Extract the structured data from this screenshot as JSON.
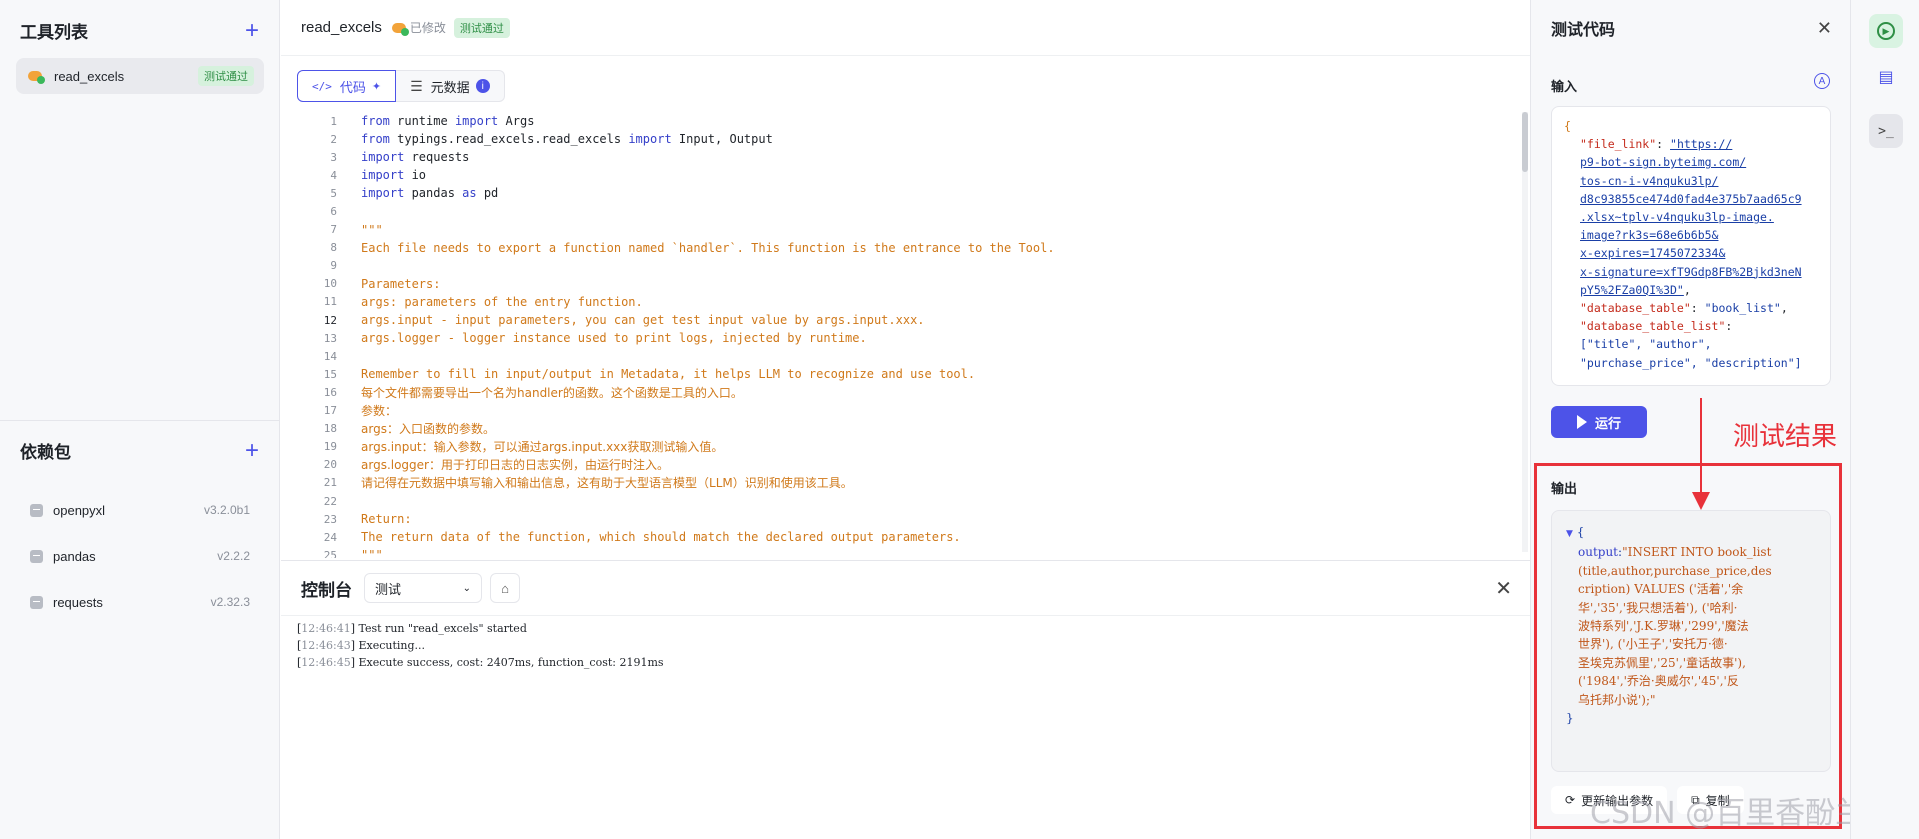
{
  "sidebar": {
    "tools_title": "工具列表",
    "tool_item": {
      "name": "read_excels",
      "status": "测试通过"
    },
    "deps_title": "依赖包",
    "deps": [
      {
        "name": "openpyxl",
        "version": "v3.2.0b1"
      },
      {
        "name": "pandas",
        "version": "v2.2.2"
      },
      {
        "name": "requests",
        "version": "v2.32.3"
      }
    ]
  },
  "header": {
    "filename": "read_excels",
    "modified": "已修改",
    "status": "测试通过"
  },
  "tabs": {
    "code": "代码",
    "metadata": "元数据"
  },
  "editor": {
    "lines": [
      "from runtime import Args",
      "from typings.read_excels.read_excels import Input, Output",
      "import requests",
      "import io",
      "import pandas as pd",
      "",
      "\"\"\"",
      "Each file needs to export a function named `handler`. This function is the entrance to the Tool.",
      "",
      "Parameters:",
      "args: parameters of the entry function.",
      "args.input - input parameters, you can get test input value by args.input.xxx.",
      "args.logger - logger instance used to print logs, injected by runtime.",
      "",
      "Remember to fill in input/output in Metadata, it helps LLM to recognize and use tool.",
      "每个文件都需要导出一个名为handler的函数。这个函数是工具的入口。",
      "参数：",
      "args：入口函数的参数。",
      "args.input：输入参数，可以通过args.input.xxx获取测试输入值。",
      "args.logger：用于打印日志的日志实例，由运行时注入。",
      "请记得在元数据中填写输入和输出信息，这有助于大型语言模型（LLM）识别和使用该工具。",
      "",
      "Return:",
      "The return data of the function, which should match the declared output parameters.",
      "\"\"\""
    ]
  },
  "console": {
    "title": "控制台",
    "select_value": "测试",
    "logs": [
      {
        "ts": "12:46:41",
        "msg": "Test run \"read_excels\" started"
      },
      {
        "ts": "12:46:43",
        "msg": "Executing..."
      },
      {
        "ts": "12:46:45",
        "msg": "Execute success, cost: 2407ms, function_cost: 2191ms"
      }
    ]
  },
  "test_panel": {
    "title": "测试代码",
    "input_label": "输入",
    "input_json": {
      "file_link_key": "\"file_link\"",
      "file_link_lines": [
        "\"https://",
        "p9-bot-sign.byteimg.com/",
        "tos-cn-i-v4nquku3lp/",
        "d8c93855ce474d0fad4e375b7aad65c9",
        ".xlsx~tplv-v4nquku3lp-image.",
        "image?rk3s=68e6b6b5&",
        "x-expires=1745072334&",
        "x-signature=xfT9Gdp8FB%2Bjkd3neN",
        "pY5%2FZa0QI%3D\""
      ],
      "db_table_key": "\"database_table\"",
      "db_table_val": "\"book_list\"",
      "db_list_key": "\"database_table_list\"",
      "db_list_line1": "[\"title\", \"author\",",
      "db_list_line2": "\"purchase_price\", \"description\"]"
    },
    "run_label": "运行",
    "output_label": "输出",
    "output_key": "output",
    "output_lines": [
      "\"INSERT INTO book_list",
      "(title,author,purchase_price,des",
      "cription) VALUES ('活着','余",
      "华','35','我只想活着'), ('哈利·",
      "波特系列','J.K.罗琳','299','魔法",
      "世界'), ('小王子','安托万·德·",
      "圣埃克苏佩里','25','童话故事'),",
      "('1984','乔治·奥威尔','45','反",
      "乌托邦小说');\""
    ],
    "update_btn": "更新输出参数",
    "copy_btn": "复制"
  },
  "annotation": {
    "label": "测试结果",
    "color": "#e8323a"
  },
  "watermark": "CSDN @百里香酚兰",
  "colors": {
    "accent": "#4d53e8",
    "success": "#2f8f46"
  }
}
